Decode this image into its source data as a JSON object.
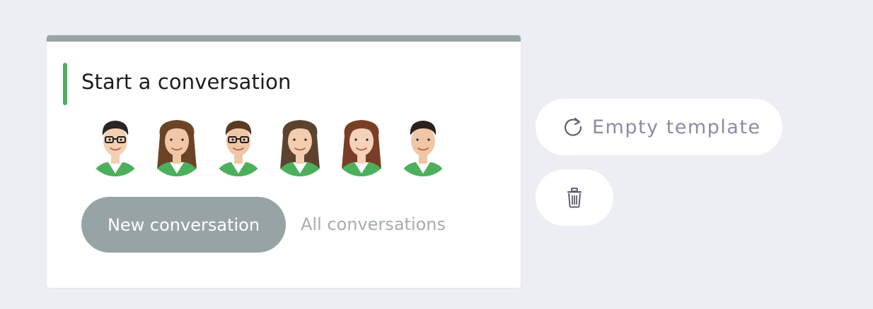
{
  "card": {
    "title": "Start a conversation",
    "accent_color": "#4caf5c",
    "topbar_color": "#9aa4a6"
  },
  "avatars": [
    {
      "name": "avatar-1",
      "hair": "#2a2522",
      "skin": "#f3cfb4",
      "glasses": true
    },
    {
      "name": "avatar-2",
      "hair": "#6b4427",
      "skin": "#f1c7a8",
      "glasses": false
    },
    {
      "name": "avatar-3",
      "hair": "#5a3a24",
      "skin": "#f0c7a6",
      "glasses": true
    },
    {
      "name": "avatar-4",
      "hair": "#5c4330",
      "skin": "#f2cdb0",
      "glasses": false
    },
    {
      "name": "avatar-5",
      "hair": "#7a3e26",
      "skin": "#f4d2bb",
      "glasses": false
    },
    {
      "name": "avatar-6",
      "hair": "#2b211c",
      "skin": "#efc6a6",
      "glasses": false
    }
  ],
  "actions": {
    "new_conversation": "New conversation",
    "all_conversations": "All conversations"
  },
  "side": {
    "empty_template": "Empty template",
    "refresh_icon": "refresh-icon",
    "trash_icon": "trash-icon"
  },
  "colors": {
    "background": "#eceef3",
    "primary_button": "#97a3a4",
    "shirt_green": "#4caf5c"
  }
}
